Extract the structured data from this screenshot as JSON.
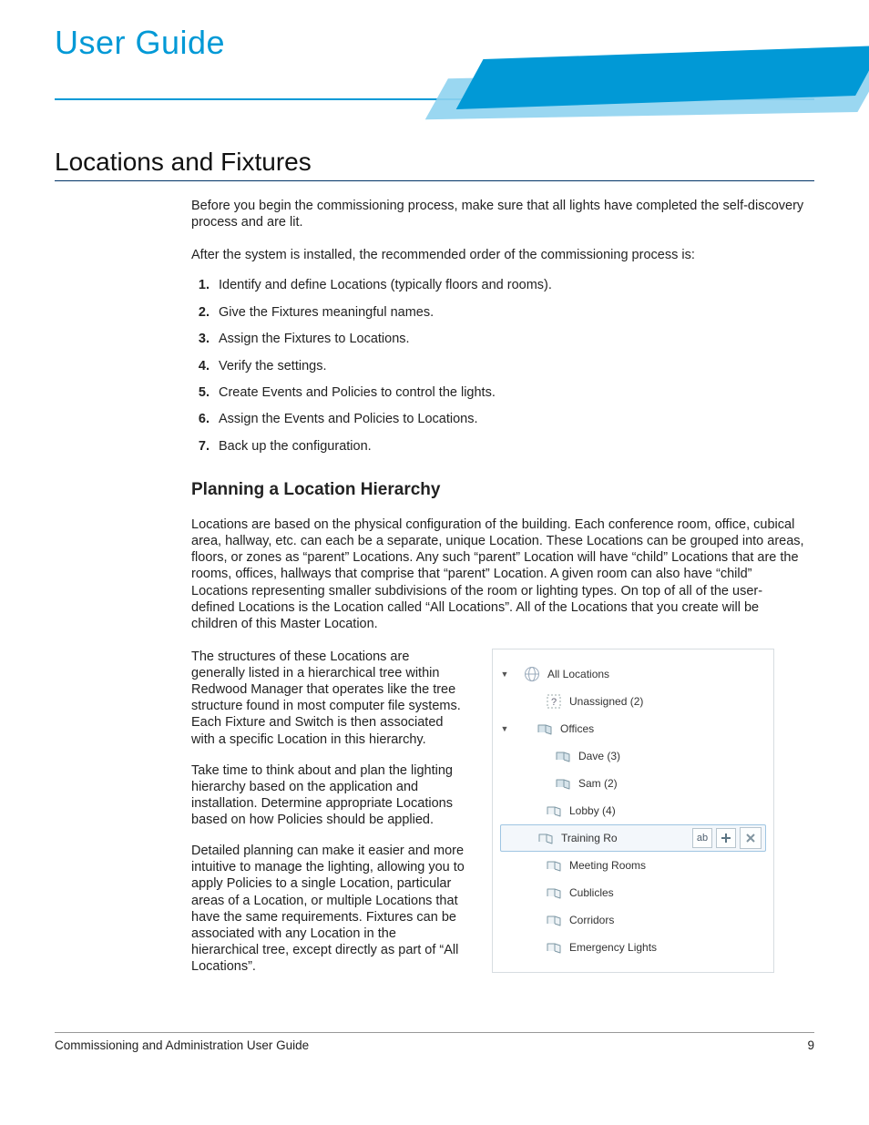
{
  "header": {
    "title": "User Guide"
  },
  "section": {
    "title": "Locations and Fixtures",
    "intro1": "Before you begin the commissioning process, make sure that all lights have completed the self-discovery process and are lit.",
    "intro2": "After the system is installed, the recommended order of the commissioning process is:",
    "steps": [
      "Identify and define Locations (typically floors and rooms).",
      "Give the Fixtures meaningful names.",
      "Assign the Fixtures to Locations.",
      "Verify the settings.",
      "Create Events and Policies to control the lights.",
      "Assign the Events and Policies to Locations.",
      "Back up the configuration."
    ],
    "sub_title": "Planning a Location Hierarchy",
    "hierarchy_para": "Locations are based on the physical configuration of the building. Each conference room, office, cubical area, hallway, etc. can each be a separate, unique Location. These Locations can be grouped into areas, floors, or zones as “parent” Locations. Any such “parent” Location will have “child” Locations that are the rooms, offices, hallways that comprise that “parent” Location. A given room can also have “child” Locations representing smaller subdivisions of the room or lighting types. On top of all of the user-defined Locations is the Location called “All Locations”. All of the Locations that you create will be children of this Master Location.",
    "left_paras": [
      "The structures of these Locations are generally listed in a hierarchical tree within Redwood Manager that operates like the tree structure found in most computer file systems. Each Fixture and Switch is then associated with a specific Location in this hierarchy.",
      "Take time to think about and plan the lighting hierarchy based on the application and installation. Determine appropriate Locations based on how Policies should be applied.",
      "Detailed planning can make it easier and more intuitive to manage the lighting, allowing you to apply Policies to a single Location, particular areas of a Location, or multiple Locations that have the same requirements. Fixtures can be associated with any Location in the hierarchical tree, except directly as part of “All Locations”."
    ]
  },
  "tree": {
    "root": "All Locations",
    "unassigned": "Unassigned (2)",
    "offices": "Offices",
    "dave": "Dave (3)",
    "sam": "Sam (2)",
    "lobby": "Lobby (4)",
    "training": "Training Ro",
    "meeting": "Meeting Rooms",
    "cubicles": "Cublicles",
    "corridors": "Corridors",
    "emergency": "Emergency Lights",
    "rename_hint": "ab",
    "add_hint": "+",
    "delete_hint": "✕"
  },
  "footer": {
    "left": "Commissioning and Administration User Guide",
    "page": "9"
  }
}
